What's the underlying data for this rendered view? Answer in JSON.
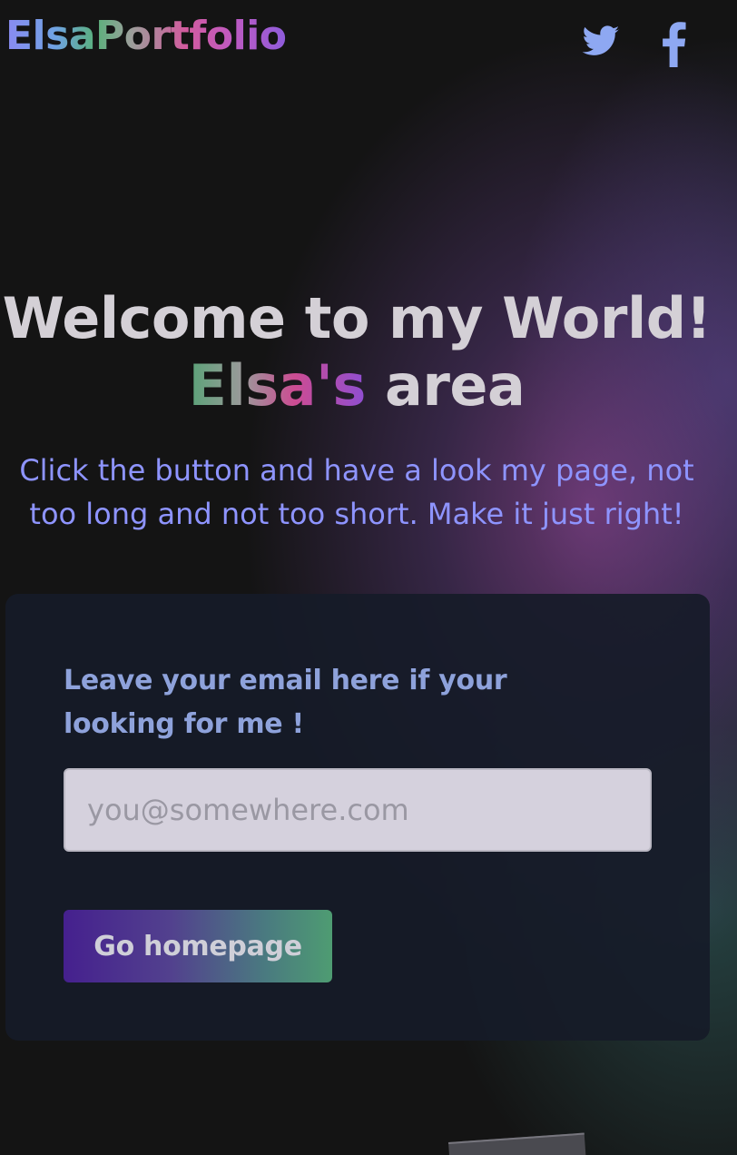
{
  "header": {
    "brand_prefix": "Elsa",
    "brand_suffix": "Portfolio",
    "social": [
      {
        "icon": "twitter-icon",
        "color": "#8ea8f2"
      },
      {
        "icon": "facebook-icon",
        "color": "#8ea8f2"
      }
    ]
  },
  "hero": {
    "title_line1": "Welcome to my World!",
    "name_text": "Elsa's",
    "area_text": "area",
    "subtitle": "Click the button and have a look my page, not too long and not too short. Make it just right!"
  },
  "form": {
    "label": "Leave your email here if your looking for me !",
    "email_placeholder": "you@somewhere.com",
    "email_value": "",
    "button_label": "Go homepage"
  },
  "colors": {
    "background": "#141414",
    "card": "#161b28",
    "subtitle": "#8e94ff",
    "label": "#8ea2db",
    "title": "#d4d0d6"
  }
}
